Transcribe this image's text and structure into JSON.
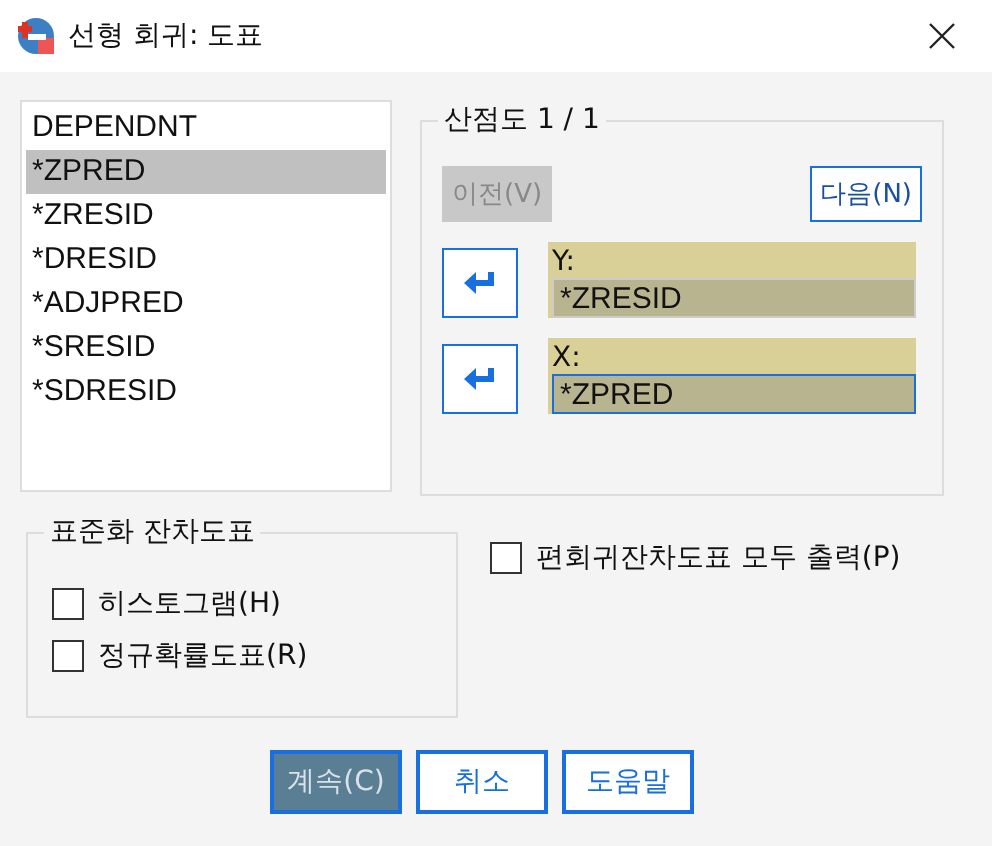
{
  "window": {
    "title": "선형 회귀: 도표"
  },
  "variables": [
    {
      "label": "DEPENDNT",
      "selected": false
    },
    {
      "label": "*ZPRED",
      "selected": true
    },
    {
      "label": "*ZRESID",
      "selected": false
    },
    {
      "label": "*DRESID",
      "selected": false
    },
    {
      "label": "*ADJPRED",
      "selected": false
    },
    {
      "label": "*SRESID",
      "selected": false
    },
    {
      "label": "*SDRESID",
      "selected": false
    }
  ],
  "scatter": {
    "title": "산점도 1 / 1",
    "prev": {
      "label": "이전(V)",
      "disabled": true
    },
    "next": {
      "label": "다음(N)",
      "disabled": false
    },
    "axes": [
      {
        "label": "Y:",
        "value": "*ZRESID",
        "focused": false
      },
      {
        "label": "X:",
        "value": "*ZPRED",
        "focused": true
      }
    ]
  },
  "std_plots": {
    "title": "표준화 잔차도표",
    "options": [
      {
        "label": "히스토그램(H)",
        "checked": false
      },
      {
        "label": "정규확률도표(R)",
        "checked": false
      }
    ]
  },
  "partial_plots": {
    "label": "편회귀잔차도표 모두 출력(P)",
    "checked": false
  },
  "buttons": [
    {
      "label": "계속(C)",
      "default": true
    },
    {
      "label": "취소",
      "default": false
    },
    {
      "label": "도움말",
      "default": false
    }
  ]
}
